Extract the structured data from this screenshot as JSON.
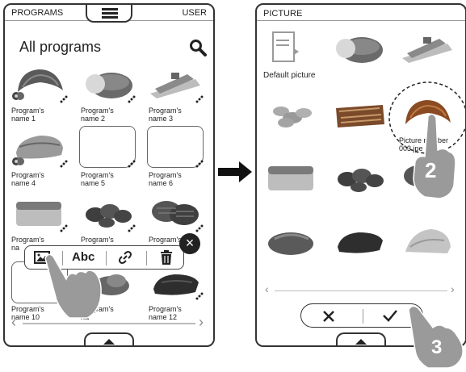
{
  "left_screen": {
    "header": {
      "left_label": "PROGRAMS",
      "right_label": "USER"
    },
    "title": "All programs",
    "programs": [
      {
        "line1": "Program's",
        "line2": "name 1"
      },
      {
        "line1": "Program's",
        "line2": "name 2"
      },
      {
        "line1": "Program's",
        "line2": "name 3"
      },
      {
        "line1": "Program's",
        "line2": "name 4"
      },
      {
        "line1": "Program's",
        "line2": "name 5"
      },
      {
        "line1": "Program's",
        "line2": "name 6"
      },
      {
        "line1": "Program's",
        "line2": "na"
      },
      {
        "line1": "Program's",
        "line2": ""
      },
      {
        "line1": "Program's",
        "line2": ""
      },
      {
        "line1": "Program's",
        "line2": "name 10"
      },
      {
        "line1": "Program's",
        "line2": "na"
      },
      {
        "line1": "Program's",
        "line2": "name 12"
      }
    ],
    "toolbar": {
      "text_button": "Abc"
    }
  },
  "right_screen": {
    "header": {
      "title": "PICTURE"
    },
    "default_picture_label": "Default picture",
    "picture_number_label": {
      "line1": "Picture number",
      "line2": "003.jpe"
    }
  },
  "steps": {
    "step2": "2",
    "step3": "3"
  },
  "colors": {
    "frame": "#333333",
    "accent_dark": "#222222",
    "hand": "#9a9a9a"
  }
}
